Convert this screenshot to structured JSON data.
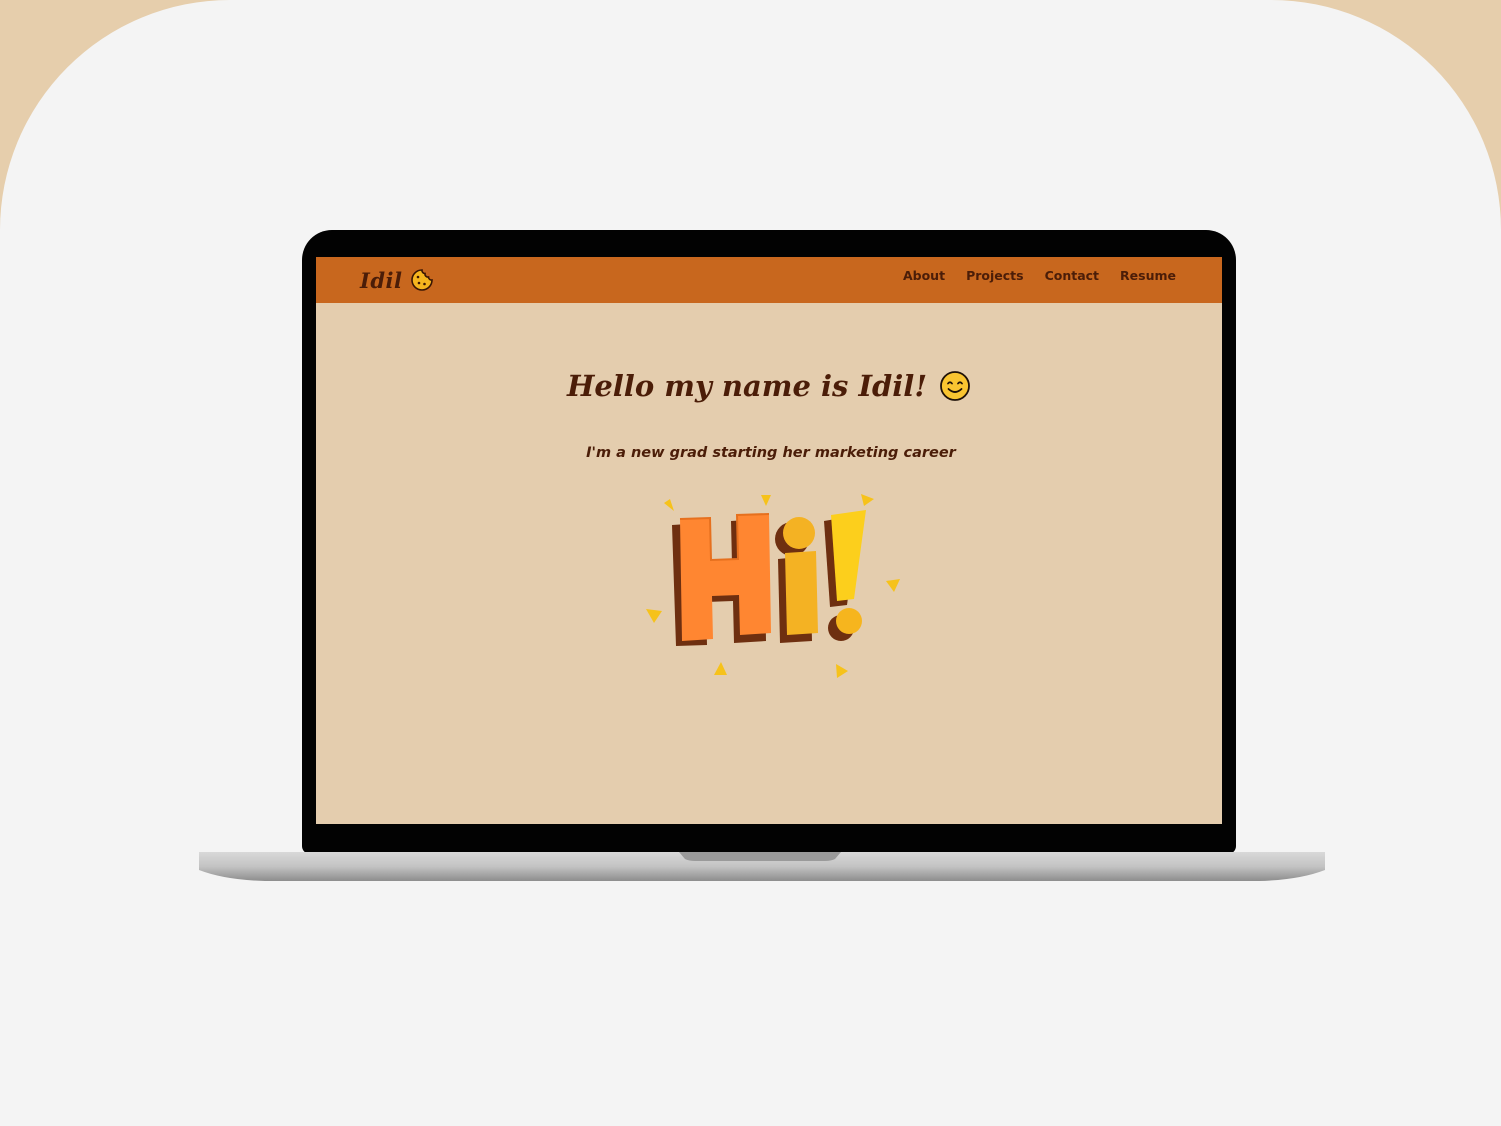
{
  "brand": {
    "name": "Idil",
    "logo_icon": "cookie-icon"
  },
  "nav": {
    "items": [
      {
        "label": "About"
      },
      {
        "label": "Projects"
      },
      {
        "label": "Contact"
      },
      {
        "label": "Resume"
      }
    ]
  },
  "hero": {
    "title": "Hello my name is Idil!",
    "title_emoji_icon": "smiling-face-icon",
    "subtitle": "I'm a new grad starting her marketing career",
    "illustration": {
      "name": "hi-illustration",
      "text": "Hi!"
    }
  },
  "colors": {
    "navbar": "#c8671e",
    "screen_background": "#e4cdae",
    "text_brown": "#4b1d08",
    "accent_orange": "#ff8631",
    "accent_yellow": "#f4b223",
    "accent_gold": "#fccf1c",
    "outer_background": "#e6ceac",
    "card_background": "#f4f4f4"
  }
}
